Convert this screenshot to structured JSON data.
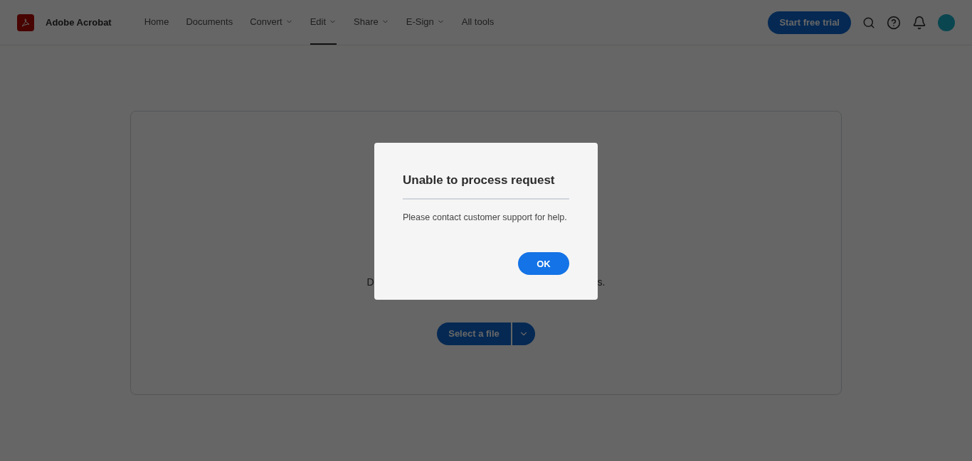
{
  "header": {
    "app_name": "Adobe Acrobat",
    "nav": [
      {
        "label": "Home",
        "selected": false,
        "has_menu": false
      },
      {
        "label": "Documents",
        "selected": false,
        "has_menu": false
      },
      {
        "label": "Convert",
        "selected": false,
        "has_menu": true
      },
      {
        "label": "Edit",
        "selected": true,
        "has_menu": true
      },
      {
        "label": "Share",
        "selected": false,
        "has_menu": true
      },
      {
        "label": "E-Sign",
        "selected": false,
        "has_menu": true
      },
      {
        "label": "All tools",
        "selected": false,
        "has_menu": false
      }
    ],
    "trial_button": "Start free trial"
  },
  "upload": {
    "hint_left": "D",
    "hint_right": "s.",
    "select_button": "Select a file"
  },
  "dialog": {
    "title": "Unable to process request",
    "message": "Please contact customer support for help.",
    "ok_button": "OK"
  }
}
